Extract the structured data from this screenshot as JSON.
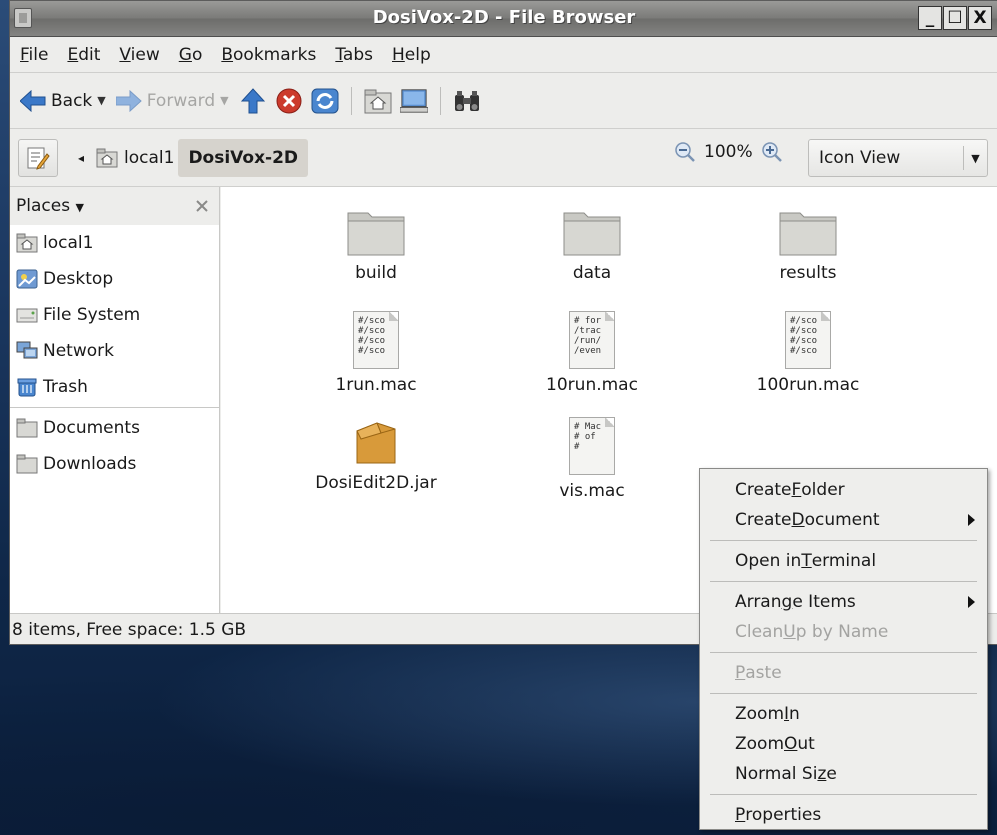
{
  "window": {
    "title": "DosiVox-2D - File Browser",
    "controls": {
      "minimize": "_",
      "maximize": "☐",
      "close": "X"
    }
  },
  "menubar": {
    "items": [
      {
        "pre": "",
        "u": "F",
        "post": "ile"
      },
      {
        "pre": "",
        "u": "E",
        "post": "dit"
      },
      {
        "pre": "",
        "u": "V",
        "post": "iew"
      },
      {
        "pre": "",
        "u": "G",
        "post": "o"
      },
      {
        "pre": "",
        "u": "B",
        "post": "ookmarks"
      },
      {
        "pre": "",
        "u": "T",
        "post": "abs"
      },
      {
        "pre": "",
        "u": "H",
        "post": "elp"
      }
    ]
  },
  "toolbar": {
    "back_label": "Back",
    "forward_label": "Forward"
  },
  "location": {
    "crumb_parent": "local1",
    "crumb_current": "DosiVox-2D",
    "zoom_level": "100%",
    "view_mode": "Icon View"
  },
  "sidebar": {
    "header": "Places",
    "items": [
      {
        "label": "local1",
        "icon": "home-folder-icon"
      },
      {
        "label": "Desktop",
        "icon": "desktop-icon"
      },
      {
        "label": "File System",
        "icon": "harddisk-icon"
      },
      {
        "label": "Network",
        "icon": "network-icon"
      },
      {
        "label": "Trash",
        "icon": "trash-icon"
      }
    ],
    "bookmarks": [
      {
        "label": "Documents",
        "icon": "folder-icon"
      },
      {
        "label": "Downloads",
        "icon": "folder-icon"
      }
    ]
  },
  "files": [
    {
      "name": "build",
      "type": "folder"
    },
    {
      "name": "data",
      "type": "folder"
    },
    {
      "name": "results",
      "type": "folder"
    },
    {
      "name": "1run.mac",
      "type": "text",
      "preview": [
        "#/sco",
        "#/sco",
        "#/sco",
        "#/sco"
      ]
    },
    {
      "name": "10run.mac",
      "type": "text",
      "preview": [
        "# for",
        "/trac",
        "/run/",
        "/even"
      ]
    },
    {
      "name": "100run.mac",
      "type": "text",
      "preview": [
        "#/sco",
        "#/sco",
        "#/sco",
        "#/sco"
      ]
    },
    {
      "name": "DosiEdit2D.jar",
      "type": "archive"
    },
    {
      "name": "vis.mac",
      "type": "text",
      "preview": [
        "# Mac",
        "# of",
        "#"
      ]
    }
  ],
  "status": {
    "text": "8 items, Free space: 1.5 GB"
  },
  "context_menu": {
    "items": [
      {
        "pre": "Create ",
        "u": "F",
        "post": "older",
        "disabled": false,
        "submenu": false
      },
      {
        "pre": "Create ",
        "u": "D",
        "post": "ocument",
        "disabled": false,
        "submenu": true
      },
      {
        "sep": true
      },
      {
        "pre": "Open in ",
        "u": "T",
        "post": "erminal",
        "disabled": false,
        "submenu": false
      },
      {
        "sep": true
      },
      {
        "pre": "Arran",
        "u": "g",
        "post": "e Items",
        "disabled": false,
        "submenu": true
      },
      {
        "pre": "Clean ",
        "u": "U",
        "post": "p by Name",
        "disabled": true,
        "submenu": false
      },
      {
        "sep": true
      },
      {
        "pre": "",
        "u": "P",
        "post": "aste",
        "disabled": true,
        "submenu": false
      },
      {
        "sep": true
      },
      {
        "pre": "Zoom ",
        "u": "I",
        "post": "n",
        "disabled": false,
        "submenu": false
      },
      {
        "pre": "Zoom ",
        "u": "O",
        "post": "ut",
        "disabled": false,
        "submenu": false
      },
      {
        "pre": "Normal Si",
        "u": "z",
        "post": "e",
        "disabled": false,
        "submenu": false
      },
      {
        "sep": true
      },
      {
        "pre": "",
        "u": "P",
        "post": "roperties",
        "disabled": false,
        "submenu": false
      }
    ]
  },
  "colors": {
    "folder_body": "#c9c9c4",
    "folder_tab": "#b4b4af",
    "jar_body": "#d89a3a",
    "arrow_blue": "#3a78c8",
    "stop_red": "#cc3a2c"
  }
}
